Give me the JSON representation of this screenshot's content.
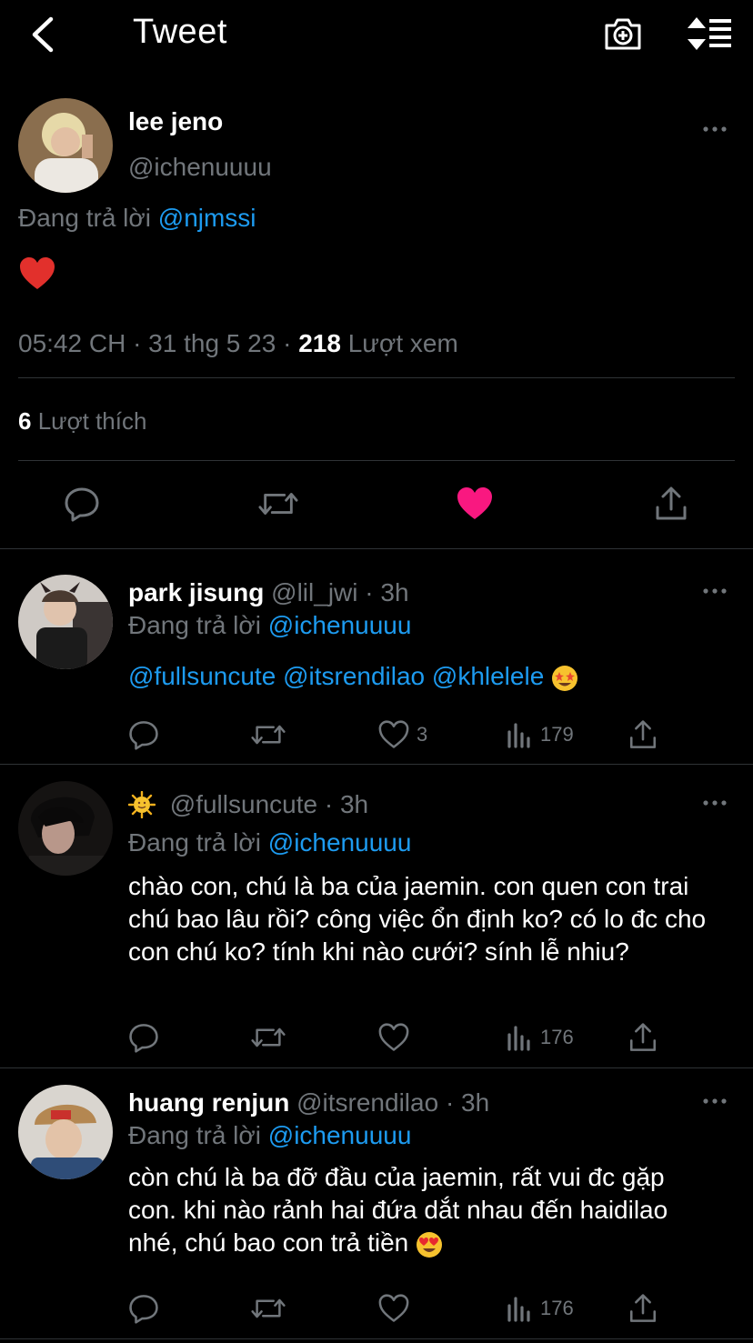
{
  "header": {
    "title": "Tweet"
  },
  "main_tweet": {
    "name": "lee jeno",
    "handle": "@ichenuuuu",
    "replying_prefix": "Đang trả lời",
    "replying_to": "@njmssi",
    "time": "05:42 CH · 31 thg 5 23 ·",
    "views_count": "218",
    "views_label": "Lượt xem",
    "likes_count": "6",
    "likes_label": "Lượt thích",
    "liked": true,
    "like_color": "#f91880"
  },
  "replies": [
    {
      "name": "park jisung",
      "handle": "@lil_jwi",
      "time": "· 3h",
      "replying_prefix": "Đang trả lời",
      "replying_to": "@ichenuuuu",
      "text": "@fullsuncute @itsrendilao @khlelele",
      "likes": "3",
      "views": "179"
    },
    {
      "name": "",
      "handle": "@fullsuncute",
      "time": "· 3h",
      "replying_prefix": "Đang trả lời",
      "replying_to": "@ichenuuuu",
      "text": "chào con, chú là ba của jaemin. con quen con trai chú bao lâu rồi? công việc ổn định ko? có lo đc cho con chú ko? tính khi nào cưới? sính lễ nhiu?",
      "likes": "",
      "views": "176"
    },
    {
      "name": "huang renjun",
      "handle": "@itsrendilao",
      "time": "· 3h",
      "replying_prefix": "Đang trả lời",
      "replying_to": "@ichenuuuu",
      "text": "còn chú là ba đỡ đầu của jaemin, rất vui đc gặp con. khi nào rảnh hai đứa dắt nhau đến haidilao nhé, chú bao con trả tiền",
      "likes": "",
      "views": "176"
    }
  ],
  "icons": {
    "back": "chevron-left-icon",
    "camera": "camera-plus-icon",
    "sort": "sort-icon",
    "reply": "reply-icon",
    "retweet": "retweet-icon",
    "like": "heart-icon",
    "views": "views-icon",
    "share": "share-icon"
  },
  "colors": {
    "link": "#1d9bf0",
    "muted": "#71767b",
    "divider": "#2f3336"
  }
}
